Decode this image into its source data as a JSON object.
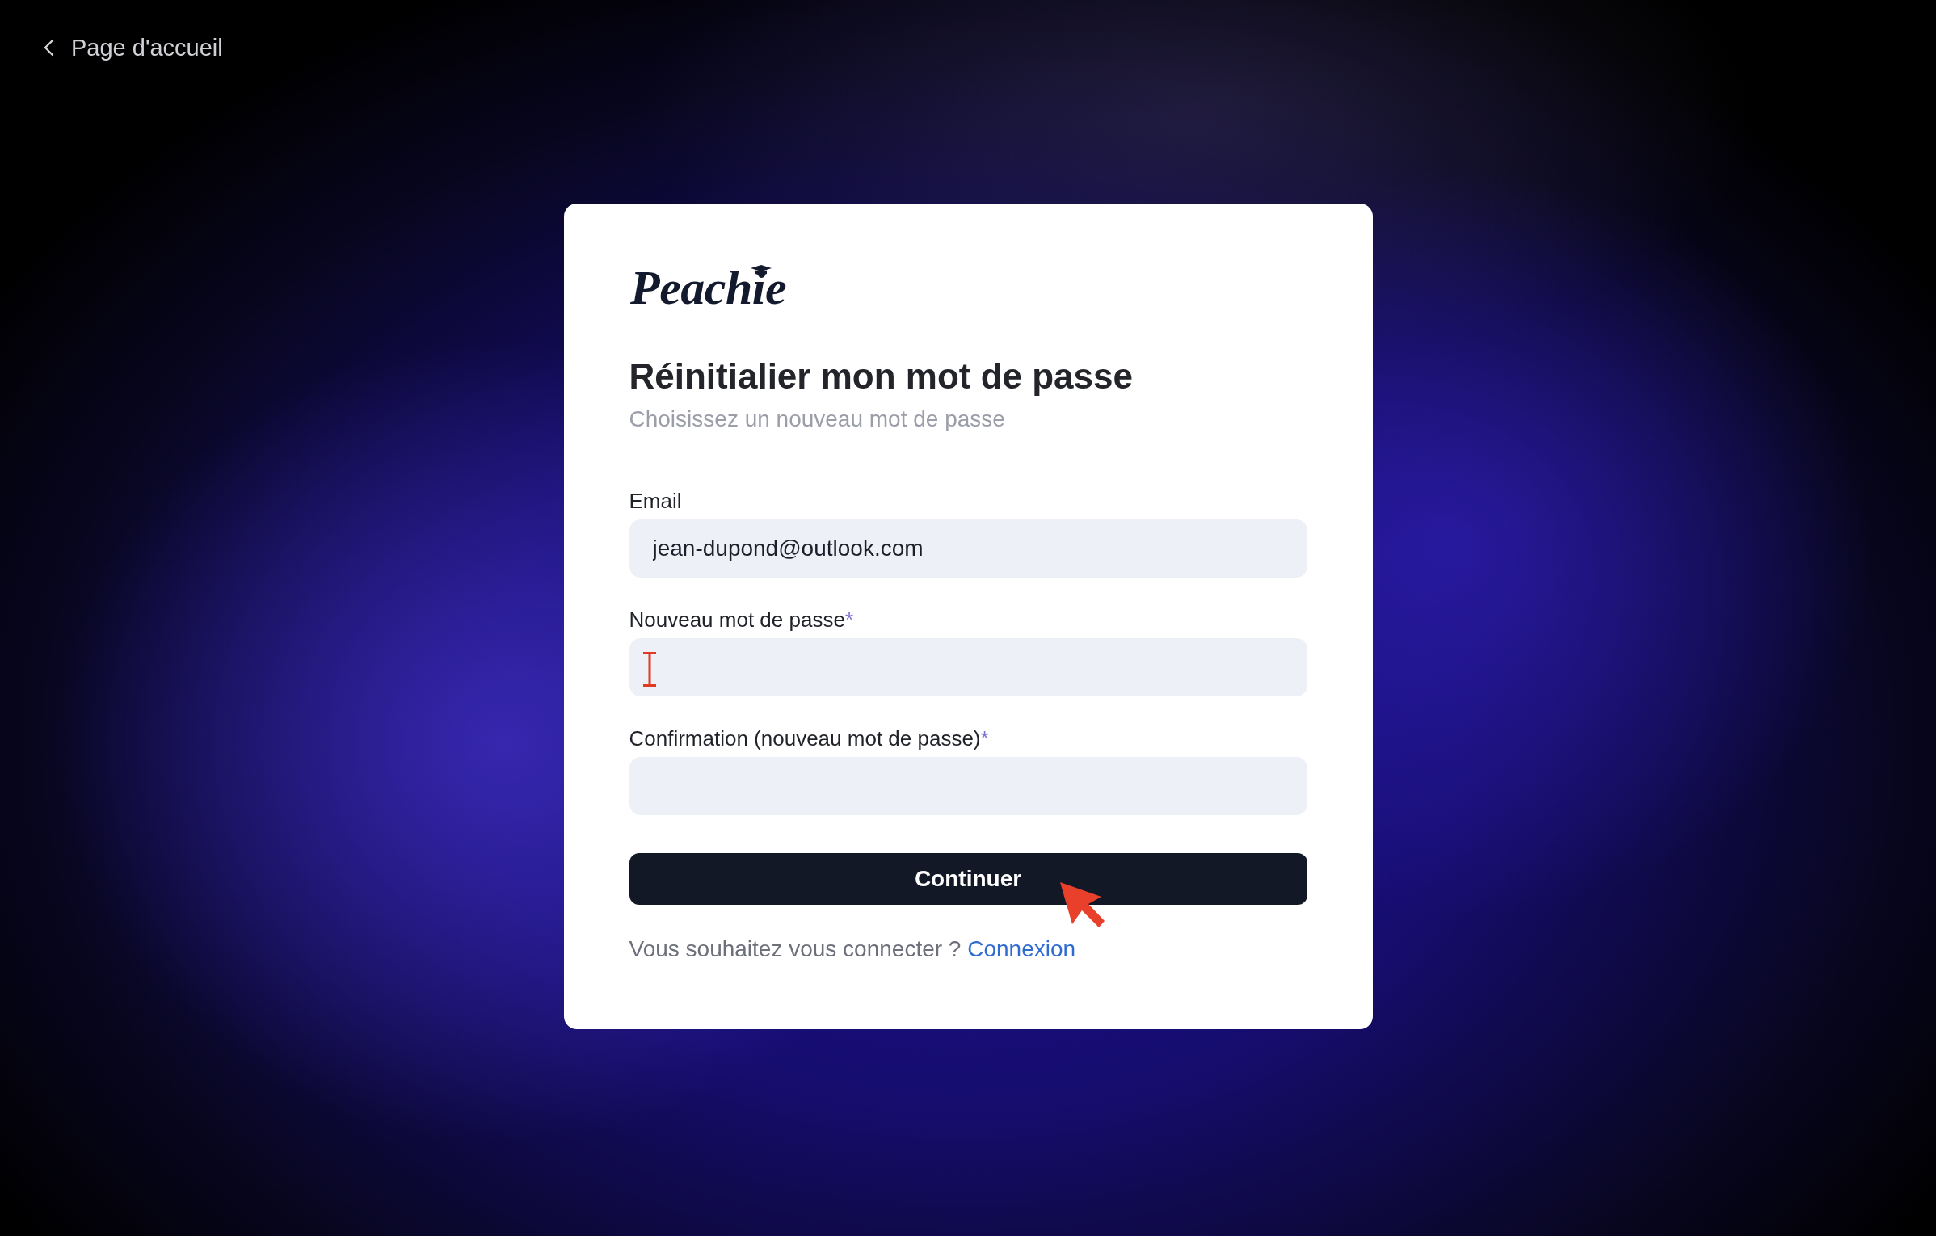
{
  "back_link": {
    "label": "Page d'accueil"
  },
  "card": {
    "logo": "Peachie",
    "title": "Réinitialier mon mot de passe",
    "subtitle": "Choisissez un nouveau mot de passe",
    "fields": [
      {
        "label": "Email",
        "value": "jean-dupond@outlook.com",
        "hovered": false
      },
      {
        "label": "Nouveau mot de passe",
        "required_mark": "*",
        "hovered": true
      },
      {
        "label": "Confirmation (nouveau mot de passe)",
        "required_mark": "*",
        "hovered": false
      }
    ],
    "submit_button": {
      "label": "Continuer",
      "hovered": true
    },
    "signin_prompt": {
      "text": "Vous souhaitez vous connecter ?",
      "link": "Connexion"
    }
  }
}
